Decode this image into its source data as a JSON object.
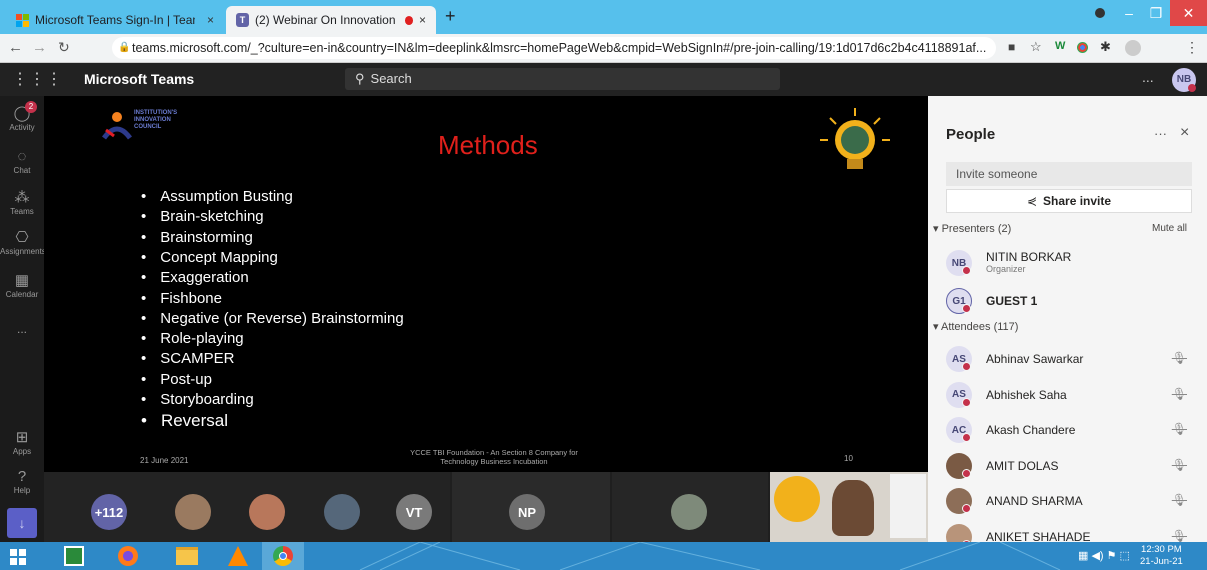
{
  "browser": {
    "tabs": [
      {
        "label": "Microsoft Teams Sign-In | Teams",
        "close": "×"
      },
      {
        "label": "(2) Webinar On Innovation a",
        "close": "×"
      }
    ],
    "new_tab": "+",
    "url": "teams.microsoft.com/_?culture=en-in&country=IN&lm=deeplink&lmsrc=homePageWeb&cmpid=WebSignIn#/pre-join-calling/19:1d017d6c2b4c4118891af..."
  },
  "teams": {
    "app_title": "Microsoft Teams",
    "search_placeholder": "Search",
    "more": "...",
    "user_initials": "NB"
  },
  "rail": [
    {
      "label": "Activity",
      "icon": "bell-icon",
      "badge": "2"
    },
    {
      "label": "Chat",
      "icon": "chat-icon"
    },
    {
      "label": "Teams",
      "icon": "teams-icon"
    },
    {
      "label": "Assignments",
      "icon": "assignments-icon"
    },
    {
      "label": "Calendar",
      "icon": "calendar-icon"
    },
    {
      "label": "...",
      "icon": "more-icon"
    },
    {
      "label": "Apps",
      "icon": "apps-icon"
    },
    {
      "label": "Help",
      "icon": "help-icon"
    }
  ],
  "slide": {
    "logo_lines": [
      "INSTITUTION'S",
      "INNOVATION",
      "COUNCIL"
    ],
    "title": "Methods",
    "bullets": [
      "Assumption Busting",
      "Brain-sketching",
      "Brainstorming",
      "Concept Mapping",
      "Exaggeration",
      "Fishbone",
      "Negative (or Reverse) Brainstorming",
      "Role-playing",
      "SCAMPER",
      "Post-up",
      "Storyboarding",
      "Reversal"
    ],
    "footer_date": "21 June 2021",
    "footer_center_1": "YCCE TBI Foundation - An Section 8 Company for",
    "footer_center_2": "Technology Business Incubation",
    "page_number": "10"
  },
  "video_strip": {
    "overflow_count": "+112",
    "avatars": [
      "VT",
      "NP"
    ]
  },
  "people": {
    "title": "People",
    "more": "···",
    "close": "×",
    "invite_placeholder": "Invite someone",
    "share_invite": "Share invite",
    "presenters_header": "Presenters (2)",
    "mute_all": "Mute all",
    "presenters": [
      {
        "initials": "NB",
        "name": "NITIN BORKAR",
        "role": "Organizer"
      },
      {
        "initials": "G1",
        "name": "GUEST 1"
      }
    ],
    "attendees_header": "Attendees (117)",
    "attendees": [
      {
        "initials": "AS",
        "name": "Abhinav Sawarkar"
      },
      {
        "initials": "AS",
        "name": "Abhishek Saha"
      },
      {
        "initials": "AC",
        "name": "Akash Chandere"
      },
      {
        "initials": "",
        "name": "AMIT DOLAS"
      },
      {
        "initials": "",
        "name": "ANAND SHARMA"
      },
      {
        "initials": "",
        "name": "ANIKET SHAHADE"
      }
    ]
  },
  "taskbar": {
    "time": "12:30 PM",
    "date": "21-Jun-21"
  },
  "colors": {
    "tab_strip": "#56c0ec",
    "teams_purple": "#6264a7",
    "slide_title": "#e0201b",
    "taskbar": "#2e89c7"
  }
}
